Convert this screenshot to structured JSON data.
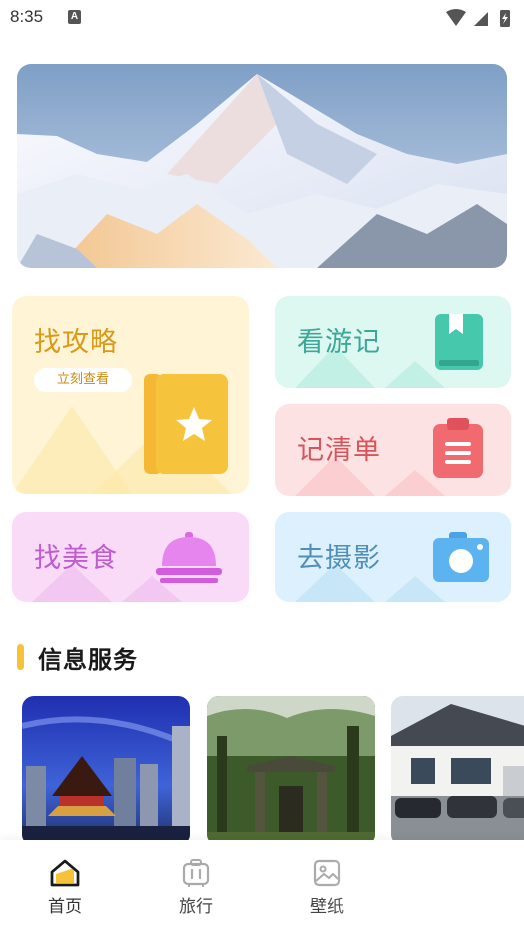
{
  "status_bar": {
    "time": "8:35",
    "notification_icon": "a-notification-icon",
    "wifi_icon": "wifi-icon",
    "signal_icon": "signal-icon",
    "battery_icon": "battery-charging-icon"
  },
  "banner": {
    "image": "snowy-mountain-peak"
  },
  "cards": {
    "guide": {
      "title": "找攻略",
      "button": "立刻查看",
      "icon": "star-book-icon",
      "color": "#d99a17"
    },
    "travelogue": {
      "title": "看游记",
      "icon": "bookmark-book-icon",
      "color": "#3aa898"
    },
    "checklist": {
      "title": "记清单",
      "icon": "clipboard-icon",
      "color": "#d8545a"
    },
    "food": {
      "title": "找美食",
      "icon": "food-cloche-icon",
      "color": "#c05cd0"
    },
    "photo": {
      "title": "去摄影",
      "icon": "camera-icon",
      "color": "#4f8fb8"
    }
  },
  "section": {
    "title": "信息服务",
    "accent": "#f6c338"
  },
  "thumbnails": [
    {
      "image": "night-city-pavilion"
    },
    {
      "image": "forest-ancient-gate"
    },
    {
      "image": "house-with-cars"
    }
  ],
  "bottom_nav": {
    "items": [
      {
        "label": "首页",
        "icon": "home-icon",
        "active": true
      },
      {
        "label": "旅行",
        "icon": "suitcase-icon",
        "active": false
      },
      {
        "label": "壁纸",
        "icon": "image-icon",
        "active": false
      }
    ]
  }
}
